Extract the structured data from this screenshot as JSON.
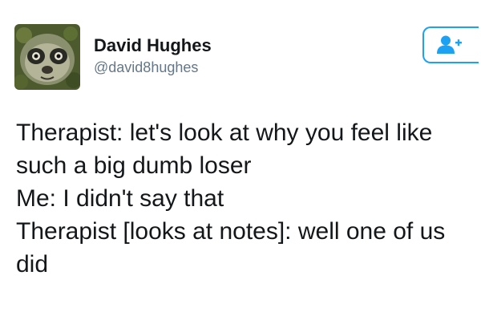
{
  "author": {
    "display_name": "David Hughes",
    "handle": "@david8hughes",
    "avatar_icon": "sloth-face-avatar"
  },
  "follow_button": {
    "icon": "add-user-icon",
    "color": "#1da1f2"
  },
  "tweet": {
    "lines": [
      "Therapist: let's look at why you feel like",
      "such a big dumb loser",
      "Me: I didn't say that",
      "Therapist [looks at notes]: well one of us",
      "did"
    ]
  }
}
